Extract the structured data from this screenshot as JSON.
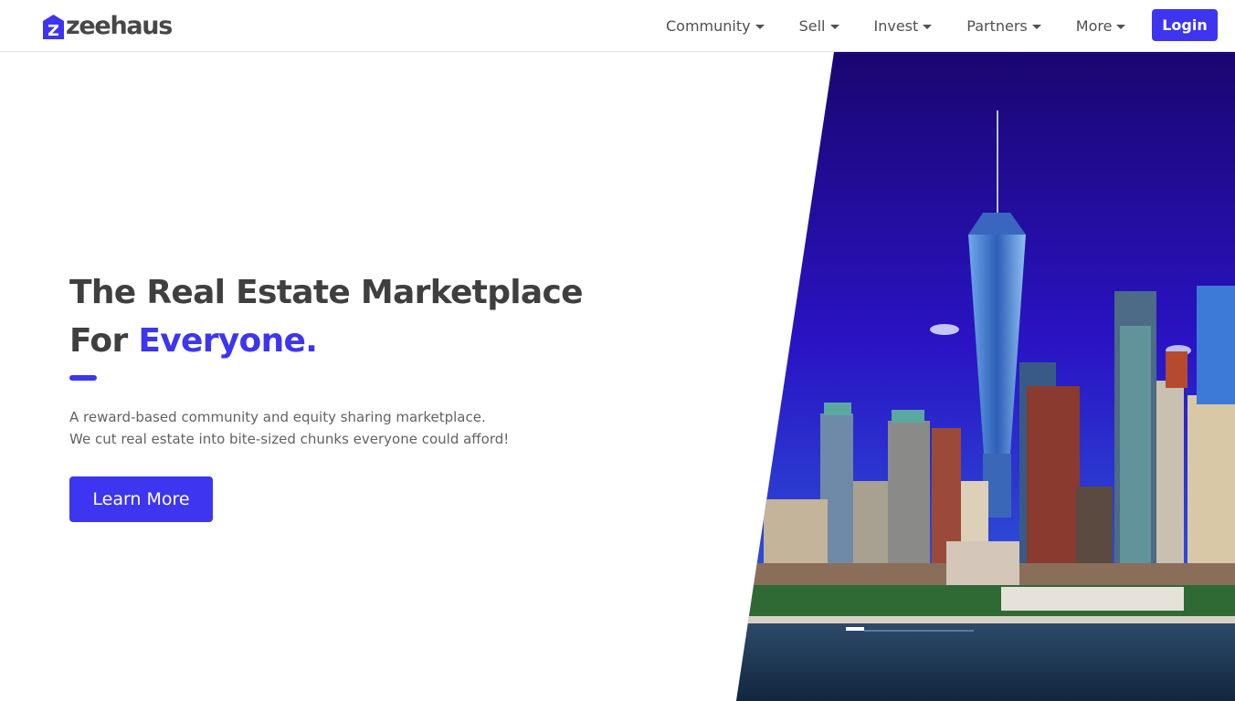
{
  "brand": {
    "name": "zeehaus",
    "color": "#3d35f0",
    "icon": "house-z-logo-icon"
  },
  "nav": {
    "items": [
      {
        "label": "Community",
        "icon": "caret-down-icon"
      },
      {
        "label": "Sell",
        "icon": "caret-down-icon"
      },
      {
        "label": "Invest",
        "icon": "caret-down-icon"
      },
      {
        "label": "Partners",
        "icon": "caret-down-icon"
      },
      {
        "label": "More",
        "icon": "caret-down-icon"
      }
    ],
    "login_label": "Login"
  },
  "hero": {
    "title_line1": "The Real Estate Marketplace",
    "title_line2_prefix": "For ",
    "title_line2_accent": "Everyone.",
    "subtitle_line1": "A reward-based community and equity sharing marketplace.",
    "subtitle_line2": "We cut real estate into bite-sized chunks everyone could afford!",
    "cta_label": "Learn More",
    "image": "city-skyline-waterfront-photo"
  },
  "colors": {
    "accent": "#3d35f0",
    "heading": "#3f3f3f",
    "body_text": "#626262",
    "nav_text": "#505050"
  }
}
